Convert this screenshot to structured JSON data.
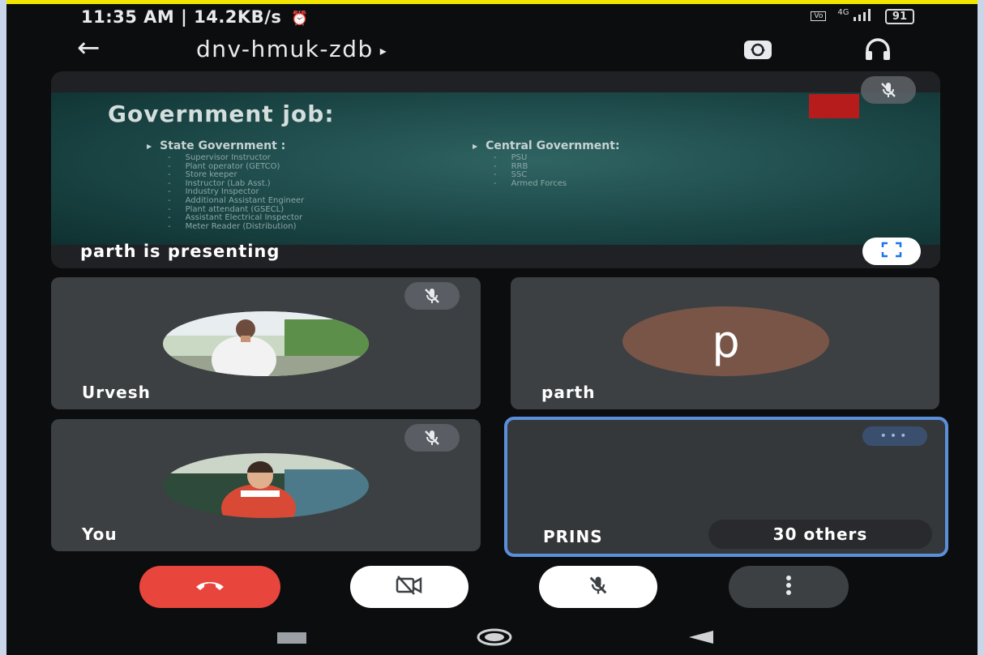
{
  "status_bar": {
    "time": "11:35 AM | 14.2KB/s",
    "network": "4G",
    "battery": "91"
  },
  "header": {
    "meeting_code": "dnv-hmuk-zdb",
    "caret": "▸"
  },
  "presentation": {
    "label": "parth is presenting",
    "slide": {
      "title": "Government job:",
      "state": {
        "heading": "State Government :",
        "items": [
          "Supervisor Instructor",
          "Plant operator (GETCO)",
          "Store keeper",
          "Instructor (Lab Asst.)",
          "Industry Inspector",
          "Additional Assistant Engineer",
          "Plant attendant (GSECL)",
          "Assistant Electrical Inspector",
          "Meter Reader (Distribution)"
        ]
      },
      "central": {
        "heading": "Central Government:",
        "items": [
          "PSU",
          "RRB",
          "SSC",
          "Armed Forces"
        ]
      }
    }
  },
  "participants": [
    {
      "name": "Urvesh",
      "muted": true
    },
    {
      "name": "parth",
      "initial": "p"
    },
    {
      "name": "You",
      "muted": true
    },
    {
      "name": "PRINS"
    }
  ],
  "others_count_label": "30 others",
  "colors": {
    "end_call": "#e8453c",
    "active_border": "#5b8fd9",
    "tile_bg": "#3c4043",
    "avatar_parth": "#795548"
  },
  "icons": [
    "back-arrow-icon",
    "switch-camera-icon",
    "headphones-icon",
    "mic-off-icon",
    "fullscreen-icon",
    "end-call-icon",
    "camera-off-icon",
    "more-vert-icon"
  ]
}
